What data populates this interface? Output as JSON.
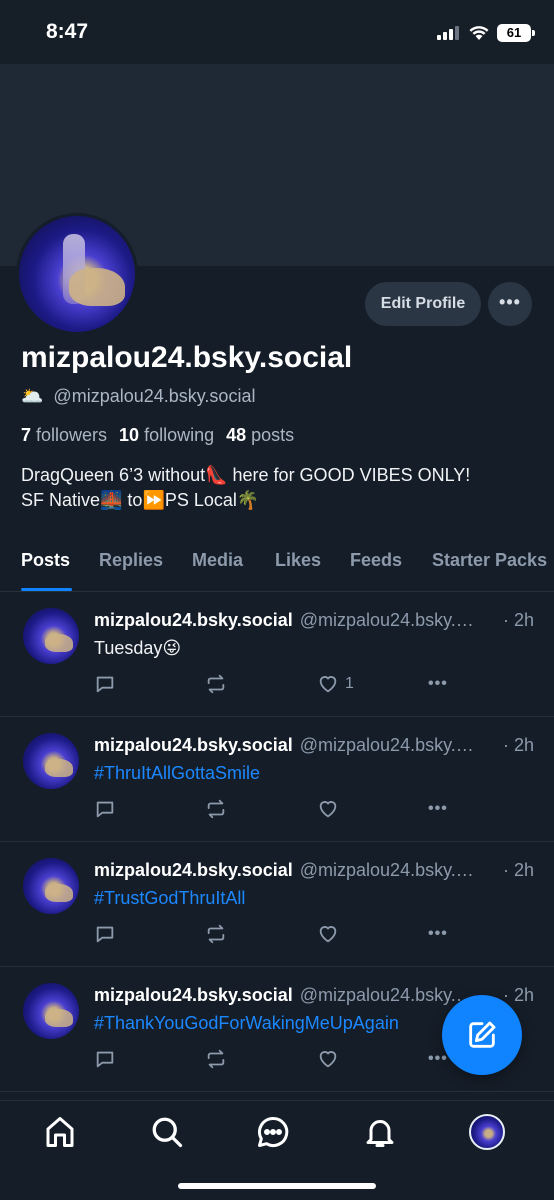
{
  "status_bar": {
    "time": "8:47",
    "battery": "61"
  },
  "profile": {
    "display_name": "mizpalou24.bsky.social",
    "handle_emoji": "🌥️",
    "handle": "@mizpalou24.bsky.social",
    "followers_count": "7",
    "followers_label": "followers",
    "following_count": "10",
    "following_label": "following",
    "posts_count": "48",
    "posts_label": "posts",
    "bio_line1": "DragQueen 6’3 without👠 here for GOOD VIBES ONLY!",
    "bio_line2": "SF Native🌉 to⏩PS Local🌴",
    "edit_button": "Edit Profile",
    "more_button": "•••"
  },
  "tabs": [
    {
      "label": "Posts",
      "active": true
    },
    {
      "label": "Replies"
    },
    {
      "label": "Media"
    },
    {
      "label": "Likes"
    },
    {
      "label": "Feeds"
    },
    {
      "label": "Starter Packs"
    }
  ],
  "posts": [
    {
      "name": "mizpalou24.bsky.social",
      "handle": "@mizpalou24.bsky.social",
      "time": "· 2h",
      "text": "Tuesday😜",
      "like_count": "1",
      "more": "•••"
    },
    {
      "name": "mizpalou24.bsky.social",
      "handle": "@mizpalou24.bsky.social",
      "time": "· 2h",
      "text": "#ThruItAllGottaSmile",
      "like_count": "",
      "more": "•••"
    },
    {
      "name": "mizpalou24.bsky.social",
      "handle": "@mizpalou24.bsky.social",
      "time": "· 2h",
      "text": "#TrustGodThruItAll",
      "like_count": "",
      "more": "•••"
    },
    {
      "name": "mizpalou24.bsky.social",
      "handle": "@mizpalou24.bsky.social",
      "time": "· 2h",
      "text": "#ThankYouGodForWakingMeUpAgain",
      "like_count": "",
      "more": "•••"
    }
  ],
  "bottom_nav": [
    "home-icon",
    "search-icon",
    "chat-icon",
    "bell-icon",
    "profile-avatar"
  ],
  "colors": {
    "accent": "#1083fe",
    "background": "#151d28",
    "hashtag": "#1c88ff"
  }
}
